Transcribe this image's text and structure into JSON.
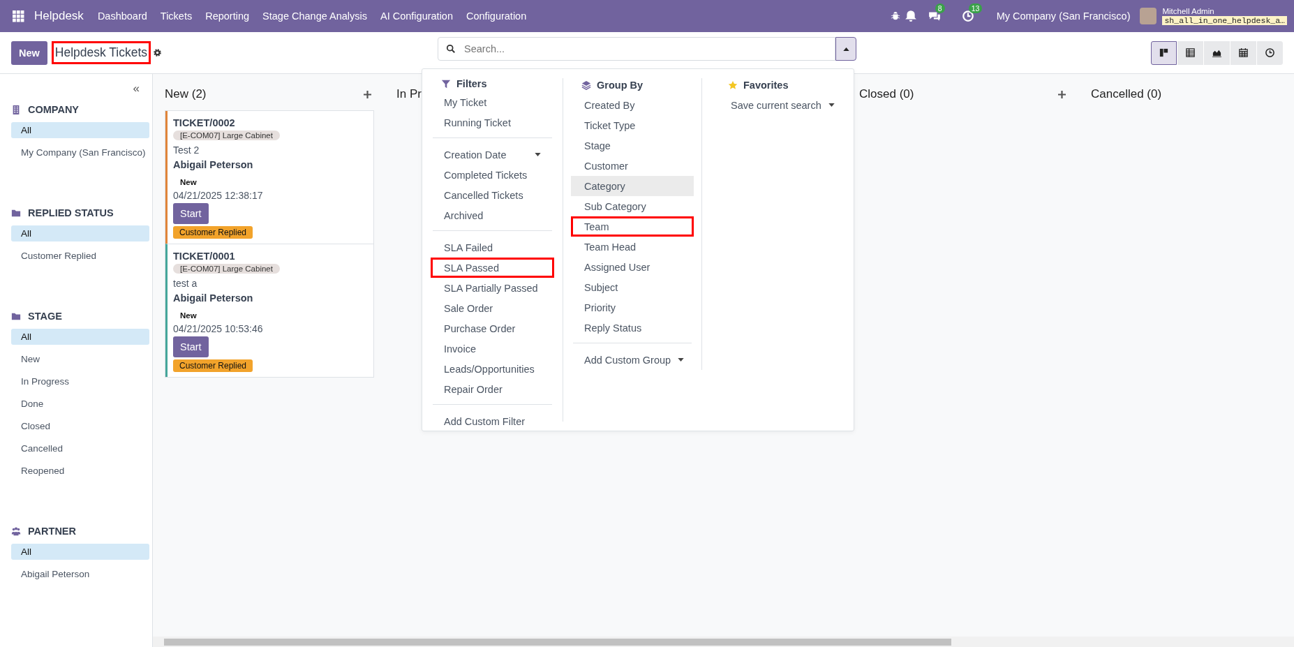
{
  "navbar": {
    "app_name": "Helpdesk",
    "menus": [
      "Dashboard",
      "Tickets",
      "Reporting",
      "Stage Change Analysis",
      "AI Configuration",
      "Configuration"
    ],
    "chat_count": "8",
    "activity_count": "13",
    "company": "My Company (San Francisco)",
    "user": "Mitchell Admin",
    "database": "sh_all_in_one_helpdesk_a…"
  },
  "control_panel": {
    "new_button": "New",
    "title": "Helpdesk Tickets",
    "title_marked": true,
    "search": {
      "placeholder": "Search..."
    },
    "menu_open": true,
    "views": [
      {
        "kind": "kanban",
        "selected": true
      },
      {
        "kind": "list",
        "selected": false
      },
      {
        "kind": "graph",
        "selected": false
      },
      {
        "kind": "calendar",
        "selected": false
      },
      {
        "kind": "activity",
        "selected": false
      }
    ]
  },
  "sidebar": {
    "collapse": "«",
    "sections": [
      {
        "kind": "company",
        "title": "COMPANY",
        "items": [
          {
            "label": "All",
            "selected": true
          },
          {
            "label": "My Company (San Francisco)",
            "selected": false
          }
        ]
      },
      {
        "kind": "folder",
        "title": "REPLIED STATUS",
        "items": [
          {
            "label": "All",
            "selected": true
          },
          {
            "label": "Customer Replied",
            "selected": false
          }
        ]
      },
      {
        "kind": "folder",
        "title": "STAGE",
        "items": [
          {
            "label": "All",
            "selected": true
          },
          {
            "label": "New",
            "selected": false
          },
          {
            "label": "In Progress",
            "selected": false
          },
          {
            "label": "Done",
            "selected": false
          },
          {
            "label": "Closed",
            "selected": false
          },
          {
            "label": "Cancelled",
            "selected": false
          },
          {
            "label": "Reopened",
            "selected": false
          }
        ]
      },
      {
        "kind": "people",
        "title": "PARTNER",
        "items": [
          {
            "label": "All",
            "selected": true
          },
          {
            "label": "Abigail Peterson",
            "selected": false
          }
        ]
      }
    ]
  },
  "columns": [
    {
      "title": "New (2)",
      "show_add": true,
      "cards": [
        {
          "name": "TICKET/0002",
          "product": "[E-COM07] Large Cabinet",
          "description": "Test 2",
          "customer": "Abigail Peterson",
          "stage": "New",
          "date": "04/21/2025 12:38:17",
          "button": "Start",
          "badge": "Customer Replied",
          "color": "#e0853a"
        },
        {
          "name": "TICKET/0001",
          "product": "[E-COM07] Large Cabinet",
          "description": "test a",
          "customer": "Abigail Peterson",
          "stage": "New",
          "date": "04/21/2025 10:53:46",
          "button": "Start",
          "badge": "Customer Replied",
          "color": "#45a69b"
        }
      ]
    },
    {
      "title": "In Pr",
      "show_add": false
    },
    {
      "title": "Closed (0)",
      "show_add": true
    },
    {
      "title": "Cancelled (0)",
      "show_add": false
    }
  ],
  "search_menu": {
    "filters": {
      "title": "Filters",
      "groups": [
        [
          {
            "label": "My Ticket",
            "kind": "option",
            "marked": false
          },
          {
            "label": "Running Ticket",
            "kind": "option",
            "marked": false
          }
        ],
        [
          {
            "label": "Creation Date",
            "kind": "dropdown",
            "marked": false
          },
          {
            "label": "Completed Tickets",
            "kind": "option",
            "marked": false
          },
          {
            "label": "Cancelled Tickets",
            "kind": "option",
            "marked": false
          },
          {
            "label": "Archived",
            "kind": "option",
            "marked": false
          }
        ],
        [
          {
            "label": "SLA Failed",
            "kind": "option",
            "marked": false
          },
          {
            "label": "SLA Passed",
            "kind": "option",
            "marked": true
          },
          {
            "label": "SLA Partially Passed",
            "kind": "option",
            "marked": false
          },
          {
            "label": "Sale Order",
            "kind": "option",
            "marked": false
          },
          {
            "label": "Purchase Order",
            "kind": "option",
            "marked": false
          },
          {
            "label": "Invoice",
            "kind": "option",
            "marked": false
          },
          {
            "label": "Leads/Opportunities",
            "kind": "option",
            "marked": false
          },
          {
            "label": "Repair Order",
            "kind": "option",
            "marked": false
          }
        ],
        [
          {
            "label": "Add Custom Filter",
            "kind": "option",
            "marked": false
          }
        ]
      ]
    },
    "group_by": {
      "title": "Group By",
      "items": [
        {
          "label": "Created By",
          "hovered": false,
          "marked": false
        },
        {
          "label": "Ticket Type",
          "hovered": false,
          "marked": false
        },
        {
          "label": "Stage",
          "hovered": false,
          "marked": false
        },
        {
          "label": "Customer",
          "hovered": false,
          "marked": false
        },
        {
          "label": "Category",
          "hovered": true,
          "marked": false
        },
        {
          "label": "Sub Category",
          "hovered": false,
          "marked": false
        },
        {
          "label": "Team",
          "hovered": false,
          "marked": true
        },
        {
          "label": "Team Head",
          "hovered": false,
          "marked": false
        },
        {
          "label": "Assigned User",
          "hovered": false,
          "marked": false
        },
        {
          "label": "Subject",
          "hovered": false,
          "marked": false
        },
        {
          "label": "Priority",
          "hovered": false,
          "marked": false
        },
        {
          "label": "Reply Status",
          "hovered": false,
          "marked": false
        }
      ],
      "custom": "Add Custom Group"
    },
    "favorites": {
      "title": "Favorites",
      "save": "Save current search"
    }
  }
}
